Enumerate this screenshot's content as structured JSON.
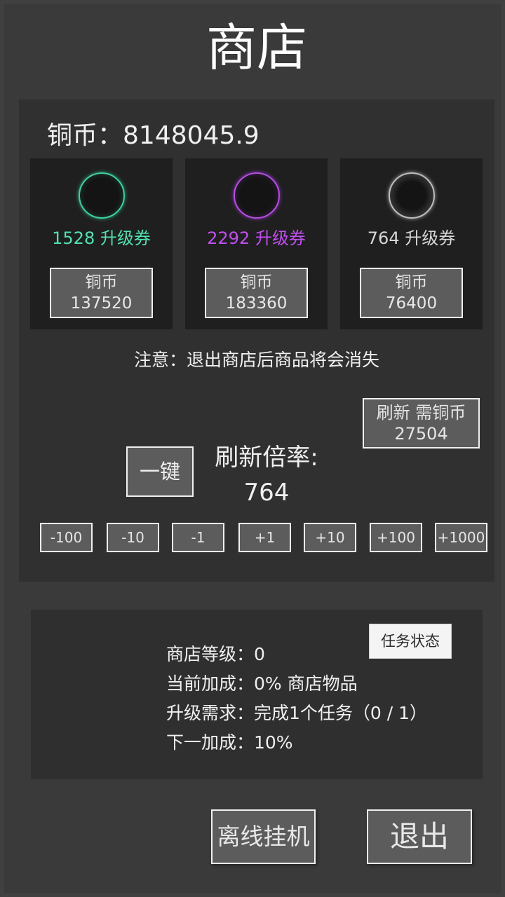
{
  "header": {
    "title": "商店"
  },
  "wallet": {
    "coins_label": "铜币：",
    "coins_value": "8148045.9"
  },
  "items": [
    {
      "amount_label": "1528 升级券",
      "price_currency": "铜币",
      "price": "137520",
      "color": "#4ee3b3",
      "icon": "green-orb-icon"
    },
    {
      "amount_label": "2292 升级券",
      "price_currency": "铜币",
      "price": "183360",
      "color": "#c24ef0",
      "icon": "purple-orb-icon"
    },
    {
      "amount_label": "764 升级券",
      "price_currency": "铜币",
      "price": "76400",
      "color": "#d8d8d8",
      "icon": "gray-orb-icon"
    }
  ],
  "notice": "注意：退出商店后商品将会消失",
  "refresh": {
    "label": "刷新 需铜币",
    "cost": "27504"
  },
  "onekey_label": "一键",
  "rate": {
    "label": "刷新倍率:",
    "value": "764"
  },
  "steps": [
    "-100",
    "-10",
    "-1",
    "+1",
    "+10",
    "+100",
    "+1000"
  ],
  "level": {
    "task_button": "任务状态",
    "shop_level": "商店等级：0",
    "current_bonus": "当前加成：0% 商店物品",
    "upgrade_req": "升级需求：完成1个任务（0 / 1）",
    "next_bonus": "下一加成：10%"
  },
  "footer": {
    "offline_label": "离线挂机",
    "exit_label": "退出"
  }
}
